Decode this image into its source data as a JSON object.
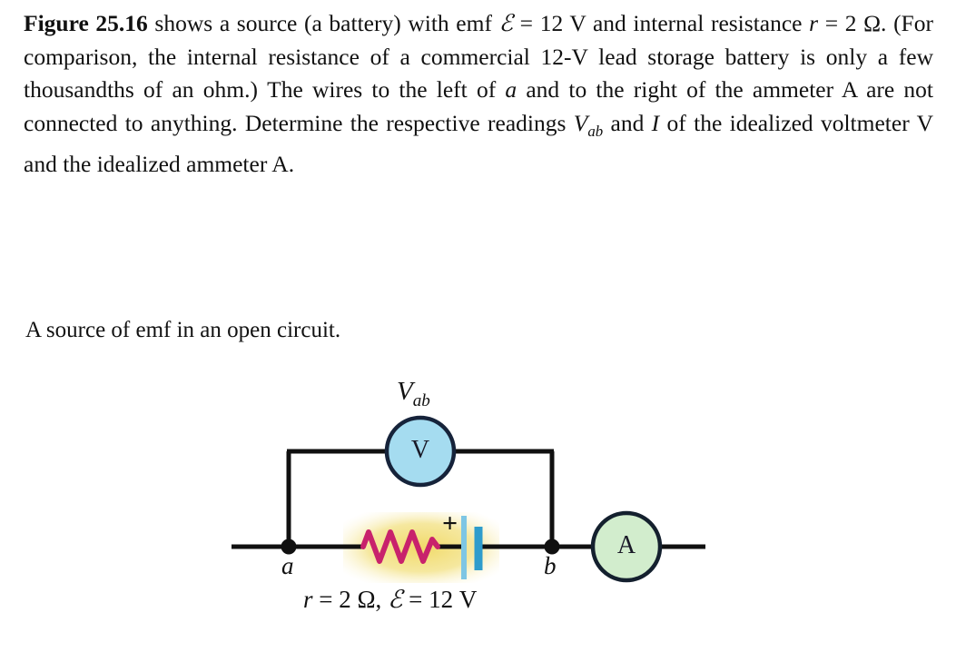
{
  "problem": {
    "lead": "Figure 25.16",
    "body_before_emf": " shows a source (a battery) with emf ",
    "emf_symbol": "ℰ",
    "emf_eq": " = 12 V and internal resistance ",
    "r_symbol": "r",
    "r_eq": " = 2 Ω. (For comparison, the internal resistance of a commercial 12-V lead storage battery is only a few thousandths of an ohm.) The wires to the left of ",
    "node_a": "a",
    "body_mid": " and to the right of the ammeter A are not connected to anything. Determine the respective readings ",
    "vab_symbol": "V",
    "vab_sub": "ab",
    "body_and": " and ",
    "current_symbol": "I",
    "body_end": " of the idealized voltmeter V and the idealized ammeter A."
  },
  "caption": "A source of emf in an open circuit.",
  "figure": {
    "voltmeter_label": "V",
    "voltmeter_reading_label": "V",
    "voltmeter_reading_sub": "ab",
    "ammeter_label": "A",
    "node_a_label": "a",
    "node_b_label": "b",
    "battery_plus_sign": "+",
    "values_r_symbol": "r",
    "values_r_text": " = 2 Ω, ",
    "values_emf_symbol": "ℰ",
    "values_emf_text": " = 12 V",
    "colors": {
      "voltmeter_fill": "#a5dcf0",
      "voltmeter_stroke": "#16233a",
      "ammeter_fill": "#d2edcd",
      "ammeter_stroke": "#14202e",
      "wire": "#101010",
      "resistor": "#c8226c",
      "battery_plate_long": "#7ec6e4",
      "battery_plate_short": "#2e9ccc",
      "highlight": "#f2e07a"
    }
  }
}
